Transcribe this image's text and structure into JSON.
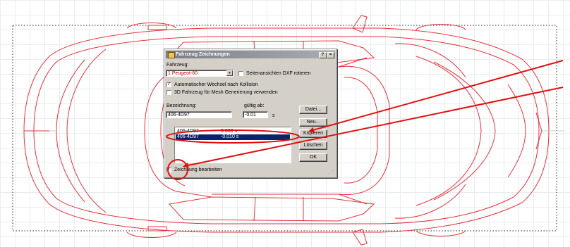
{
  "dialog": {
    "title": "Fahrzeug Zeichnungen",
    "help_label": "?",
    "close_label": "×",
    "vehicle_label": "Fahrzeug:",
    "vehicle_value": "1 Peugeot-60",
    "dropdown_arrow": "▼",
    "rotate_dxf_label": "Seitenansichten DXF rotieren",
    "rotate_dxf_checked": "",
    "auto_change_label": "Automatischer Wechsel nach Kollision",
    "auto_change_checked": "✓",
    "mesh_label": "3D Fahrzeug für Mesh Generierung verwenden",
    "mesh_checked": "",
    "designation_label": "Bezeichnung:",
    "designation_value": "406-4D97",
    "valid_from_label": "gültig ab:",
    "valid_from_value": "-0.01",
    "unit_label": "s",
    "list_rows": [
      {
        "name": "406-4D97",
        "time": "0.000 s",
        "selected": false
      },
      {
        "name": "406-4D97",
        "time": "-0.010 s",
        "selected": true
      }
    ],
    "edit_drawing_label": "Zeichnung bearbeiten",
    "edit_drawing_checked": "✓",
    "buttons": {
      "file": "Datei...",
      "new": "Neu...",
      "copy": "Kopieren",
      "delete": "Löschen",
      "ok": "OK"
    },
    "resize_grip": "⋰"
  },
  "colors": {
    "drawing_line": "#e8323c",
    "annotation_red": "#e01010",
    "selection_blue": "#0a246a",
    "dialog_face": "#d4d0c8"
  }
}
